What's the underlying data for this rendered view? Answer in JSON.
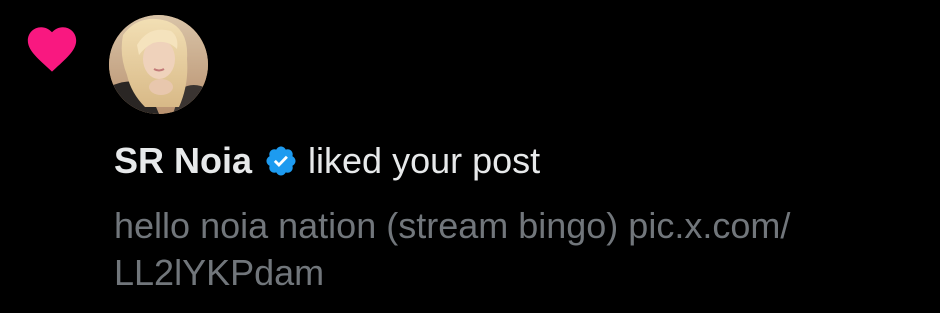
{
  "notification": {
    "type_icon": "heart-icon",
    "type_icon_color": "#f91880",
    "avatar_icon": "avatar-photo",
    "user_name": "SR Noia",
    "verified_icon": "verified-badge-icon",
    "verified_color": "#1d9bf0",
    "action_text": "liked your post",
    "post_text_line1": "hello noia nation (stream bingo) pic.x.com/",
    "post_text_line2": "LL2lYKPdam"
  },
  "colors": {
    "background": "#000000",
    "primary_text": "#e7e9ea",
    "secondary_text": "#71767b"
  }
}
